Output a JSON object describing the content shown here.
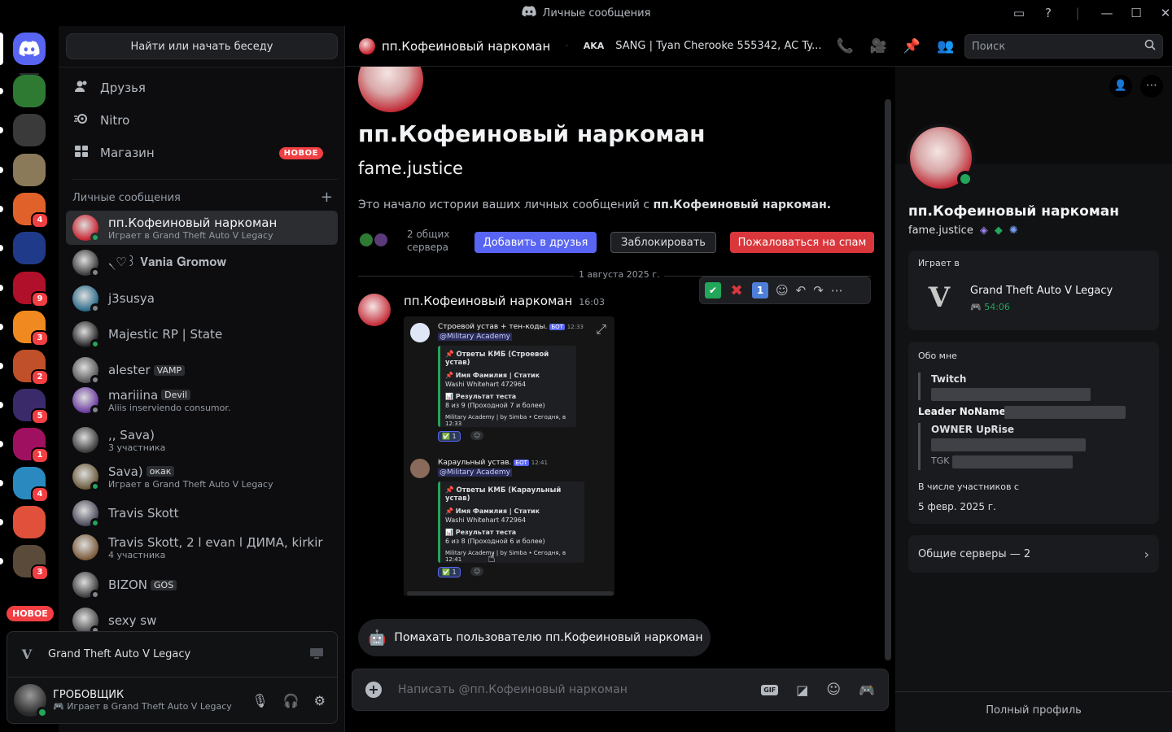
{
  "window": {
    "title": "Личные сообщения"
  },
  "sidebar": {
    "find_button": "Найти или начать беседу",
    "nav": [
      {
        "label": "Друзья",
        "icon": "friends-icon"
      },
      {
        "label": "Nitro",
        "icon": "nitro-icon"
      },
      {
        "label": "Магазин",
        "icon": "shop-icon",
        "badge": "НОВОЕ"
      }
    ],
    "dm_header": "Личные сообщения",
    "dm_add": "+",
    "dms": [
      {
        "name": "пп.Кофеиновый наркоман",
        "sub": "Играет в Grand Theft Auto V Legacy",
        "status": "online",
        "active": true
      },
      {
        "name": "৲♡꒱ 𝐕𝐚𝐧𝐢𝐚 𝐆𝐫𝐨𝐦𝐨𝐰",
        "sub": "",
        "status": "offline"
      },
      {
        "name": "j3susya",
        "sub": "",
        "status": "offline"
      },
      {
        "name": "Majestic RP | State",
        "sub": "",
        "status": "online"
      },
      {
        "name": "alester",
        "tag": "VAMP",
        "sub": "",
        "status": "offline"
      },
      {
        "name": "mariiina",
        "tag": "Devil",
        "sub": "Aliis inserviendo consumor.",
        "status": "offline"
      },
      {
        "name": ",, Sava)",
        "sub": "3 участника",
        "status": "group"
      },
      {
        "name": "Sava)",
        "tag": "окак",
        "sub": "Играет в Grand Theft Auto V Legacy",
        "status": "online"
      },
      {
        "name": "Travis Skott",
        "sub": "",
        "status": "online"
      },
      {
        "name": "Travis Skott, 2 l evan l ДИМА, kirkir",
        "sub": "4 участника",
        "status": "group"
      },
      {
        "name": "BIZON",
        "tag": "GOS",
        "sub": "",
        "status": "offline"
      },
      {
        "name": "sexy sw",
        "sub": "",
        "status": "offline"
      }
    ],
    "new_badge": "НОВОЕ",
    "activity": "Grand Theft Auto V Legacy",
    "user": {
      "name": "ГРОБОВЩИК",
      "sub": "Играет в Grand Theft Auto V Legacy"
    }
  },
  "servers": [
    {
      "badge": ""
    },
    {
      "badge": ""
    },
    {
      "badge": ""
    },
    {
      "badge": "4"
    },
    {
      "badge": ""
    },
    {
      "badge": "9"
    },
    {
      "badge": "3"
    },
    {
      "badge": "2"
    },
    {
      "badge": "5"
    },
    {
      "badge": "1"
    },
    {
      "badge": "4"
    },
    {
      "badge": ""
    },
    {
      "badge": "3"
    }
  ],
  "header": {
    "name": "пп.Кофеиновый наркоман",
    "aka_label": "AKA",
    "aka": "SANG | Tyan Cherooke 555342, AC Ty...",
    "search_placeholder": "Поиск"
  },
  "chat": {
    "profile_name": "пп.Кофеиновый наркоман",
    "profile_user": "fame.justice",
    "intro_prefix": "Это начало истории ваших личных сообщений с ",
    "intro_name": "пп.Кофеиновый наркоман.",
    "mutual": "2 общих\nсервера",
    "add_friend": "Добавить в друзья",
    "block": "Заблокировать",
    "report": "Пожаловаться на спам",
    "date_divider": "1 августа 2025 г.",
    "message": {
      "author": "пп.Кофеиновый наркоман",
      "time": "16:03"
    },
    "reaction_icons": [
      "✅",
      "❌",
      "1"
    ],
    "embed1": {
      "author": "Строевой устав + тен-коды.",
      "bot": "БОТ",
      "time": "12:33",
      "mention": "@Military Academy",
      "l1": "📌 Ответы КМБ (Строевой устав)",
      "l2": "📌 Имя Фамилия | Статик",
      "l3": "Washi Whitehart 472964",
      "l4": "📊 Результат теста",
      "l5": "8 из 9 (Проходной 7 и более)",
      "l6": "Military Academy | by Simba • Сегодня, в 12:33",
      "react": "✅ 1"
    },
    "embed2": {
      "author": "Караульный устав.",
      "bot": "БОТ",
      "time": "12:41",
      "mention": "@Military Academy",
      "l1": "📌 Ответы КМБ (Караульный устав)",
      "l2": "📌 Имя Фамилия | Статик",
      "l3": "Washi Whitehart 472964",
      "l4": "📊 Результат теста",
      "l5": "6 из 8 (Проходной 6 и более)",
      "l6": "Military Academy | by Simba • Сегодня, в 12:41",
      "react": "✅ 1"
    },
    "wave": "Помахать пользователю пп.Кофеиновый наркоман",
    "composer_placeholder": "Написать @пп.Кофеиновый наркоман",
    "gif_label": "GIF"
  },
  "profile": {
    "name": "пп.Кофеиновый наркоман",
    "user": "fame.justice",
    "playing_label": "Играет в",
    "game": "Grand Theft Auto V Legacy",
    "game_time": "54:06",
    "about_label": "Обо мне",
    "about_twitch": "Twitch",
    "about_leader": "Leader NoName",
    "about_owner": "OWNER UpRise",
    "about_tgk": "TGK",
    "member_label": "В числе участников с",
    "member_since": "5 февр. 2025 г.",
    "mutual_servers": "Общие серверы — 2",
    "full_profile": "Полный профиль"
  },
  "colors": {
    "blurple": "#5865f2",
    "red": "#da373c",
    "green": "#23a55a"
  }
}
